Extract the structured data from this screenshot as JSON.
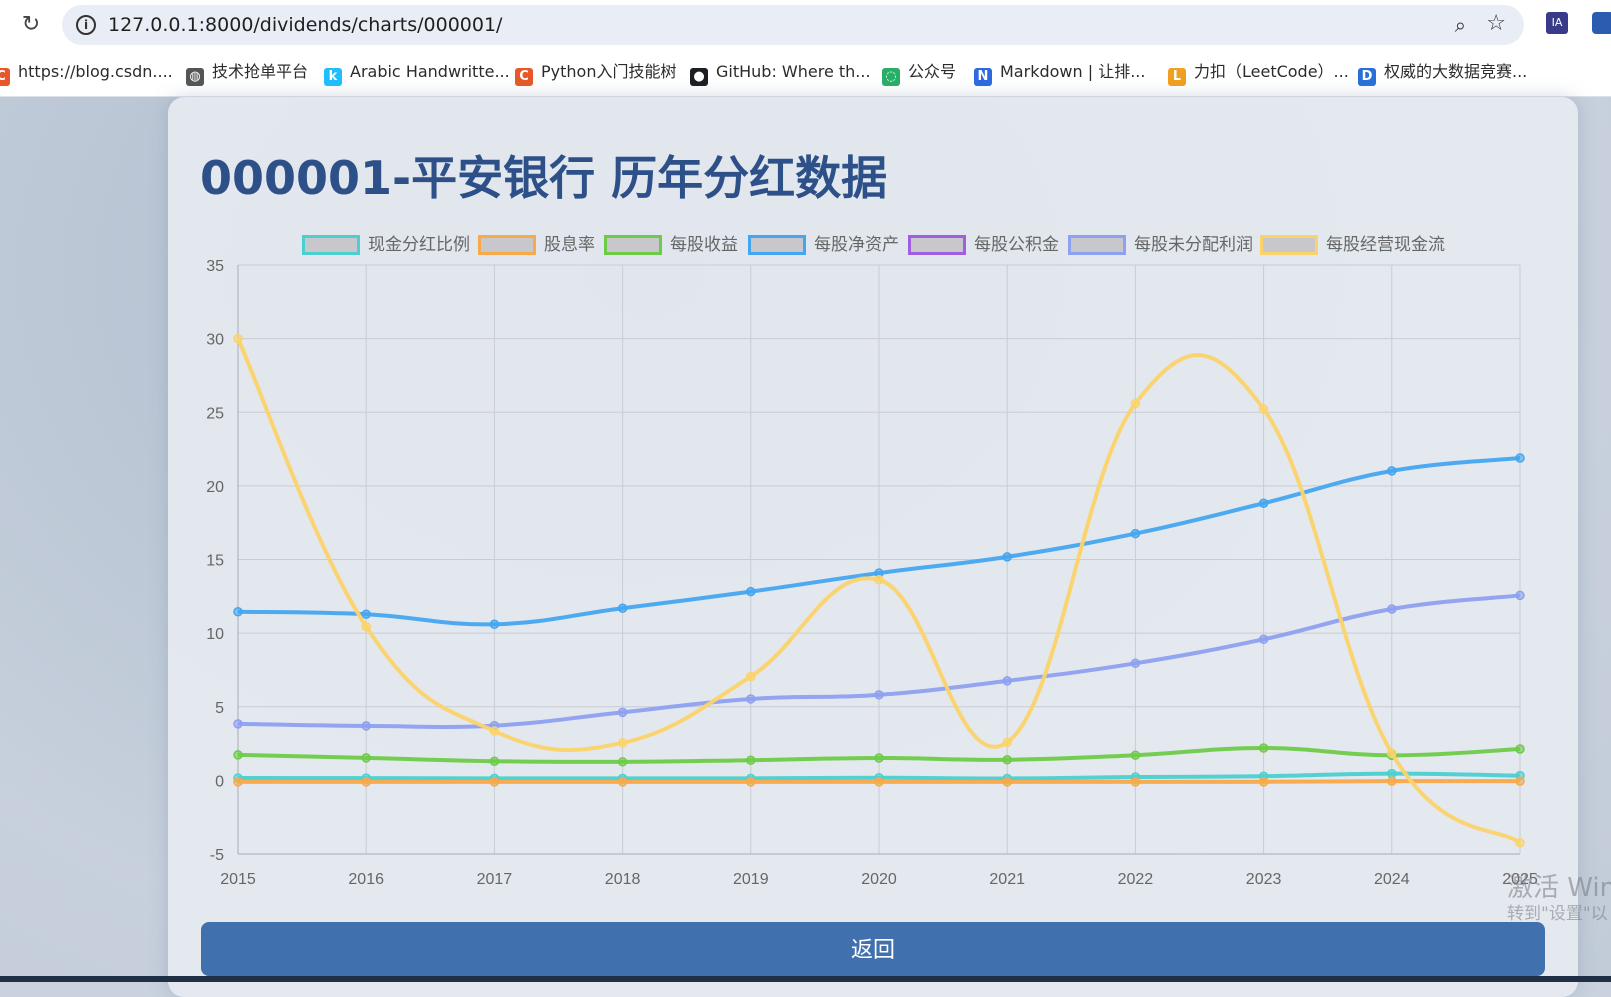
{
  "browser": {
    "url": "127.0.0.1:8000/dividends/charts/000001/",
    "ext1_label": "IA",
    "bookmarks": [
      {
        "label": "https://blog.csdn....",
        "icon": "csdn-icon",
        "color": "#e8572a",
        "glyph": "C"
      },
      {
        "label": "技术抢单平台",
        "icon": "globe-icon",
        "color": "#555555",
        "glyph": "◍"
      },
      {
        "label": "Arabic Handwritte...",
        "icon": "kaggle-icon",
        "color": "#20beff",
        "glyph": "k"
      },
      {
        "label": "Python入门技能树",
        "icon": "csdn-icon",
        "color": "#e8572a",
        "glyph": "C"
      },
      {
        "label": "GitHub: Where th...",
        "icon": "github-icon",
        "color": "#1b1f23",
        "glyph": "●"
      },
      {
        "label": "公众号",
        "icon": "wechat-icon",
        "color": "#2aae67",
        "glyph": "◌"
      },
      {
        "label": "Markdown | 让排...",
        "icon": "markdown-icon",
        "color": "#2d6ae0",
        "glyph": "N"
      },
      {
        "label": "力扣（LeetCode）...",
        "icon": "leetcode-icon",
        "color": "#f0a020",
        "glyph": "ᒪ"
      },
      {
        "label": "权威的大数据竞赛...",
        "icon": "datafountain-icon",
        "color": "#2a6fd8",
        "glyph": "D"
      }
    ]
  },
  "page": {
    "title": "000001-平安银行 历年分红数据",
    "return_label": "返回"
  },
  "watermark": {
    "line1": "激活 Win",
    "line2": "转到\"设置\"以"
  },
  "chart_data": {
    "type": "line",
    "title": "",
    "xlabel": "",
    "ylabel": "",
    "ylim": [
      -5,
      35
    ],
    "yticks": [
      -5,
      0,
      5,
      10,
      15,
      20,
      25,
      30,
      35
    ],
    "grid": true,
    "legend_position": "top",
    "categories": [
      "2015",
      "2016",
      "2017",
      "2018",
      "2019",
      "2020",
      "2021",
      "2022",
      "2023",
      "2024",
      "2025"
    ],
    "series": [
      {
        "name": "现金分红比例",
        "color": "#4bd0cf",
        "values": [
          0.16,
          0.15,
          0.14,
          0.14,
          0.14,
          0.18,
          0.13,
          0.23,
          0.28,
          0.46,
          0.32
        ]
      },
      {
        "name": "股息率",
        "color": "#f8a94a",
        "values": [
          -0.1,
          -0.1,
          -0.1,
          -0.1,
          -0.1,
          -0.1,
          -0.1,
          -0.1,
          -0.1,
          -0.05,
          -0.05
        ]
      },
      {
        "name": "每股收益",
        "color": "#6ecb48",
        "values": [
          1.73,
          1.53,
          1.3,
          1.26,
          1.37,
          1.52,
          1.4,
          1.71,
          2.2,
          1.7,
          2.13
        ]
      },
      {
        "name": "每股净资产",
        "color": "#44a6f0",
        "values": [
          11.45,
          11.28,
          10.6,
          11.69,
          12.82,
          14.08,
          15.18,
          16.76,
          18.82,
          21.02,
          21.89
        ]
      },
      {
        "name": "每股公积金",
        "color": "#a05ee0",
        "values": [],
        "hidden": true
      },
      {
        "name": "每股未分配利润",
        "color": "#8ea0f0",
        "values": [
          3.84,
          3.7,
          3.72,
          4.62,
          5.53,
          5.81,
          6.76,
          7.95,
          9.58,
          11.64,
          12.56
        ]
      },
      {
        "name": "每股经营现金流",
        "color": "#fcd36a",
        "values": [
          30.0,
          10.44,
          3.35,
          2.55,
          7.05,
          13.62,
          2.58,
          25.59,
          25.22,
          1.85,
          -4.24
        ]
      }
    ]
  }
}
